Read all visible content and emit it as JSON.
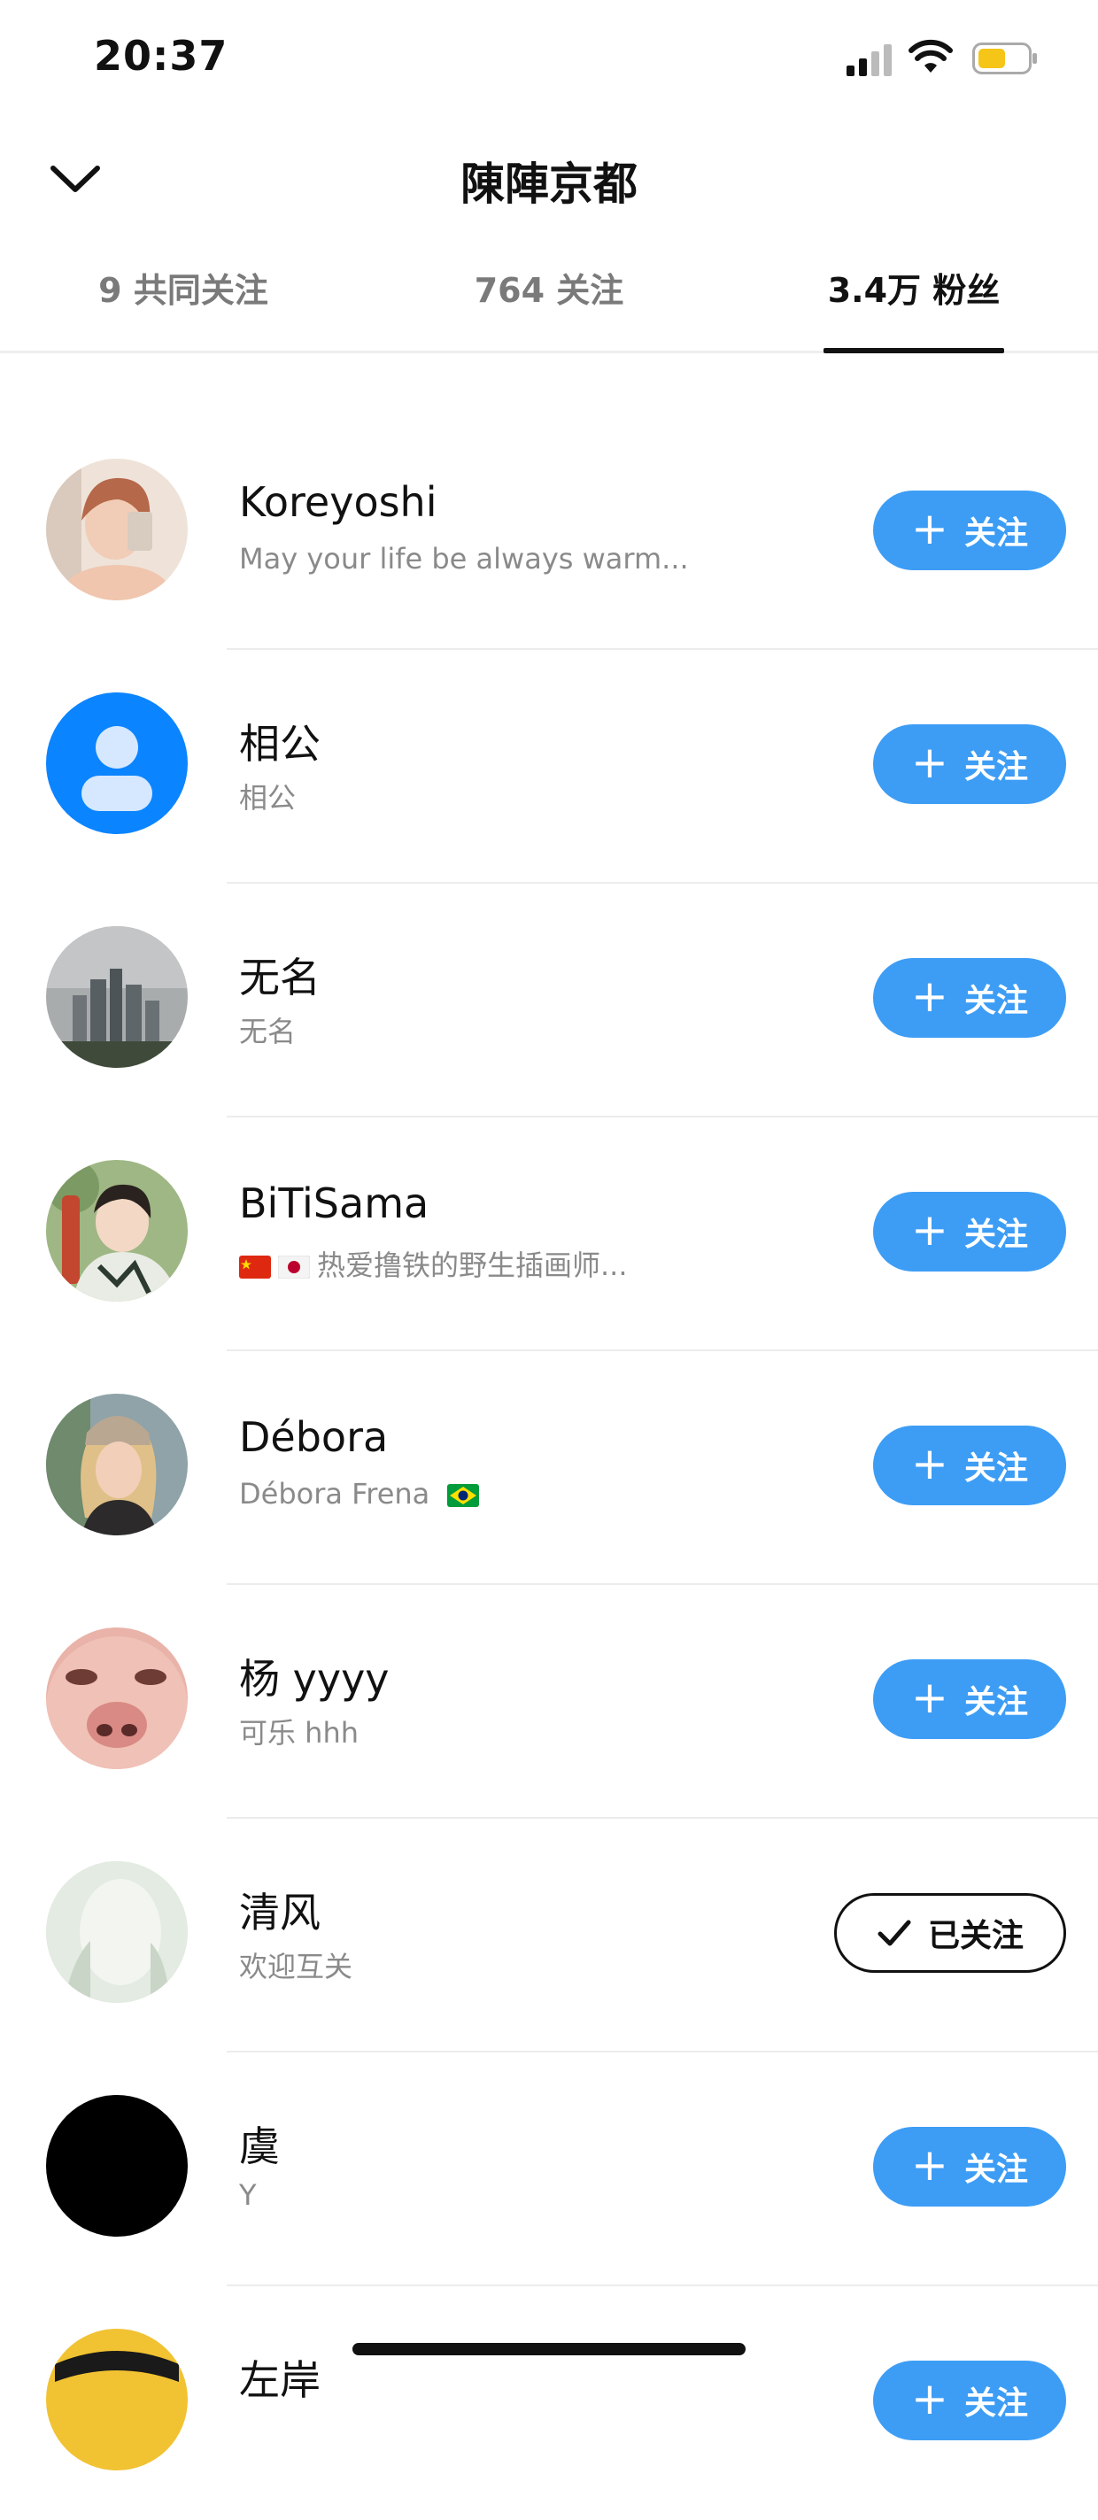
{
  "status_bar": {
    "time": "20:37"
  },
  "header": {
    "title": "陳陣京都"
  },
  "tabs": [
    {
      "label": "9 共同关注"
    },
    {
      "label": "764 关注"
    },
    {
      "label": "3.4万 粉丝",
      "active": true
    }
  ],
  "users": [
    {
      "name": "Koreyoshi",
      "desc": "May your life be always warm...",
      "button": "关注",
      "followed": false
    },
    {
      "name": "相公",
      "desc": "相公",
      "button": "关注",
      "followed": false
    },
    {
      "name": "无名",
      "desc": "无名",
      "button": "关注",
      "followed": false
    },
    {
      "name": "BiTiSama",
      "desc": "热爱撸铁的野生插画师...",
      "button": "关注",
      "followed": false
    },
    {
      "name": "Débora",
      "desc": "Débora Frena",
      "button": "关注",
      "followed": false
    },
    {
      "name": "杨 yyyy",
      "desc": "可乐 hhh",
      "button": "关注",
      "followed": false
    },
    {
      "name": "清风",
      "desc": "欢迎互关",
      "button": "已关注",
      "followed": true
    },
    {
      "name": "虞",
      "desc": "Y",
      "button": "关注",
      "followed": false
    },
    {
      "name": "左岸",
      "desc": "",
      "button": "关注",
      "followed": false
    }
  ],
  "colors": {
    "accent": "#3d9df5",
    "text": "#111111",
    "secondary": "#8a8a8a"
  }
}
